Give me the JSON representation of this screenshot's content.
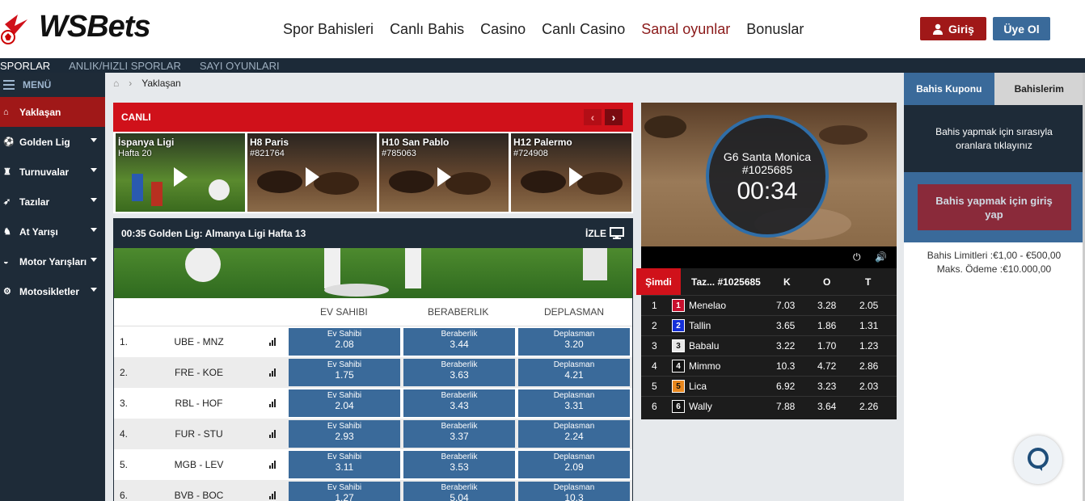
{
  "header": {
    "logo_text": "WSBets",
    "nav": [
      "Spor Bahisleri",
      "Canlı Bahis",
      "Casino",
      "Canlı Casino",
      "Sanal oyunlar",
      "Bonuslar"
    ],
    "active_nav": "Sanal oyunlar",
    "login_label": "Giriş",
    "signup_label": "Üye Ol"
  },
  "subnav": [
    "SPORLAR",
    "ANLIK/HIZLI SPORLAR",
    "SAYI OYUNLARI"
  ],
  "sidebar": {
    "menu_label": "MENÜ",
    "items": [
      {
        "label": "Yaklaşan",
        "icon": "home-icon",
        "active": true
      },
      {
        "label": "Golden Lig",
        "icon": "soccer-ball-icon"
      },
      {
        "label": "Turnuvalar",
        "icon": "trophy-icon"
      },
      {
        "label": "Tazılar",
        "icon": "greyhound-icon"
      },
      {
        "label": "At Yarışı",
        "icon": "horse-icon"
      },
      {
        "label": "Motor Yarışları",
        "icon": "car-icon"
      },
      {
        "label": "Motosikletler",
        "icon": "motorcycle-icon"
      }
    ]
  },
  "breadcrumb": {
    "current": "Yaklaşan"
  },
  "live": {
    "title": "CANLI",
    "cards": [
      {
        "title": "İspanya Ligi",
        "sub": "Hafta 20"
      },
      {
        "title": "H8 Paris",
        "sub": "#821764"
      },
      {
        "title": "H10 San Pablo",
        "sub": "#785063"
      },
      {
        "title": "H12 Palermo",
        "sub": "#724908"
      }
    ]
  },
  "match": {
    "header": "00:35 Golden Lig: Almanya Ligi  Hafta 13",
    "watch_label": "İZLE",
    "columns": [
      "EV SAHIBI",
      "BERABERLIK",
      "DEPLASMAN"
    ],
    "odd_labels": [
      "Ev Sahibi",
      "Beraberlik",
      "Deplasman"
    ],
    "rows": [
      {
        "n": "1.",
        "teams": "UBE - MNZ",
        "odds": [
          "2.08",
          "3.44",
          "3.20"
        ]
      },
      {
        "n": "2.",
        "teams": "FRE - KOE",
        "odds": [
          "1.75",
          "3.63",
          "4.21"
        ]
      },
      {
        "n": "3.",
        "teams": "RBL - HOF",
        "odds": [
          "2.04",
          "3.43",
          "3.31"
        ]
      },
      {
        "n": "4.",
        "teams": "FUR - STU",
        "odds": [
          "2.93",
          "3.37",
          "2.24"
        ]
      },
      {
        "n": "5.",
        "teams": "MGB - LEV",
        "odds": [
          "3.11",
          "3.53",
          "2.09"
        ]
      },
      {
        "n": "6.",
        "teams": "BVB - BOC",
        "odds": [
          "1.27",
          "5.04",
          "10.3"
        ]
      }
    ]
  },
  "video": {
    "event": "G6 Santa Monica",
    "id": "#1025685",
    "timer": "00:34"
  },
  "race": {
    "now_label": "Şimdi",
    "title": "Taz... #1025685",
    "cols": [
      "K",
      "O",
      "T"
    ],
    "runners": [
      {
        "pos": "1",
        "silk": "1",
        "name": "Menelao",
        "silk_color": "#c8102e",
        "silk_text": "#ffffff",
        "k": "7.03",
        "o": "3.28",
        "t": "2.05"
      },
      {
        "pos": "2",
        "silk": "2",
        "name": "Tallin",
        "silk_color": "#1530d8",
        "silk_text": "#ffffff",
        "k": "3.65",
        "o": "1.86",
        "t": "1.31"
      },
      {
        "pos": "3",
        "silk": "3",
        "name": "Babalu",
        "silk_color": "#e8e8e8",
        "silk_text": "#111111",
        "k": "3.22",
        "o": "1.70",
        "t": "1.23"
      },
      {
        "pos": "4",
        "silk": "4",
        "name": "Mimmo",
        "silk_color": "#111111",
        "silk_text": "#ffffff",
        "k": "10.3",
        "o": "4.72",
        "t": "2.86"
      },
      {
        "pos": "5",
        "silk": "5",
        "name": "Lica",
        "silk_color": "#e8871e",
        "silk_text": "#111111",
        "k": "6.92",
        "o": "3.23",
        "t": "2.03"
      },
      {
        "pos": "6",
        "silk": "6",
        "name": "Wally",
        "silk_color": "#111111",
        "silk_text": "#ffffff",
        "k": "7.88",
        "o": "3.64",
        "t": "2.26"
      }
    ]
  },
  "betslip": {
    "tabs": [
      "Bahis Kuponu",
      "Bahislerim"
    ],
    "info": "Bahis yapmak için sırasıyla oranlara tıklayınız",
    "login_prompt": "Bahis yapmak için giriş yap",
    "limits": "Bahis Limitleri :€1,00 - €500,00",
    "max_payout": "Maks. Ödeme :€10.000,00"
  }
}
